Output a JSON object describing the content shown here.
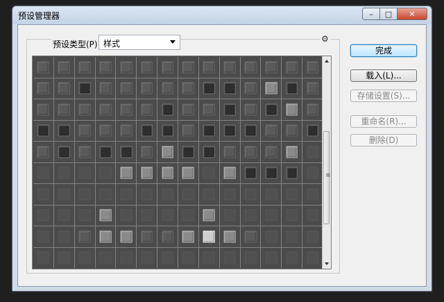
{
  "window": {
    "title": "预设管理器",
    "controls": {
      "minimize": "–",
      "maximize": "□",
      "close": "✕"
    }
  },
  "preset": {
    "label": "预设类型(P):",
    "selected": "样式"
  },
  "gear_icon": "⚙",
  "buttons": {
    "done": "完成",
    "load": "载入(L)...",
    "save": "存储设置(S)...",
    "rename": "重命名(R)...",
    "delete": "删除(D)"
  },
  "grid": {
    "rows": 10,
    "cols": 14,
    "swatch_tones": [
      "n",
      "n",
      "n",
      "n",
      "n",
      "n",
      "n",
      "n",
      "n",
      "n",
      "n",
      "n",
      "n",
      "n",
      "n",
      "n",
      "d",
      "n",
      "n",
      "n",
      "n",
      "n",
      "d",
      "d",
      "n",
      "l",
      "d",
      "n",
      "n",
      "n",
      "n",
      "n",
      "n",
      "n",
      "d",
      "n",
      "n",
      "d",
      "n",
      "d",
      "l",
      "n",
      "d",
      "d",
      "n",
      "n",
      "n",
      "d",
      "d",
      "n",
      "d",
      "d",
      "d",
      "n",
      "n",
      "d",
      "n",
      "d",
      "n",
      "d",
      "d",
      "n",
      "l",
      "d",
      "d",
      "n",
      "n",
      "n",
      "l",
      "f",
      "f",
      "f",
      "f",
      "f",
      "l",
      "l",
      "l",
      "l",
      "f",
      "l",
      "d",
      "d",
      "d",
      "f",
      "f",
      "f",
      "f",
      "f",
      "f",
      "f",
      "f",
      "f",
      "f",
      "f",
      "f",
      "f",
      "f",
      "f",
      "f",
      "f",
      "f",
      "l",
      "f",
      "f",
      "f",
      "f",
      "l",
      "f",
      "f",
      "f",
      "f",
      "f",
      "f",
      "f",
      "n",
      "l",
      "l",
      "n",
      "n",
      "l",
      "b",
      "l",
      "n",
      "f",
      "f",
      "f",
      "f",
      "f",
      "f",
      "f",
      "f",
      "f",
      "f",
      "f",
      "f",
      "f",
      "f",
      "f",
      "f",
      "f"
    ]
  },
  "colors": {
    "accent_button": "#bde6fd",
    "grid_background": "#4b4b4b"
  }
}
